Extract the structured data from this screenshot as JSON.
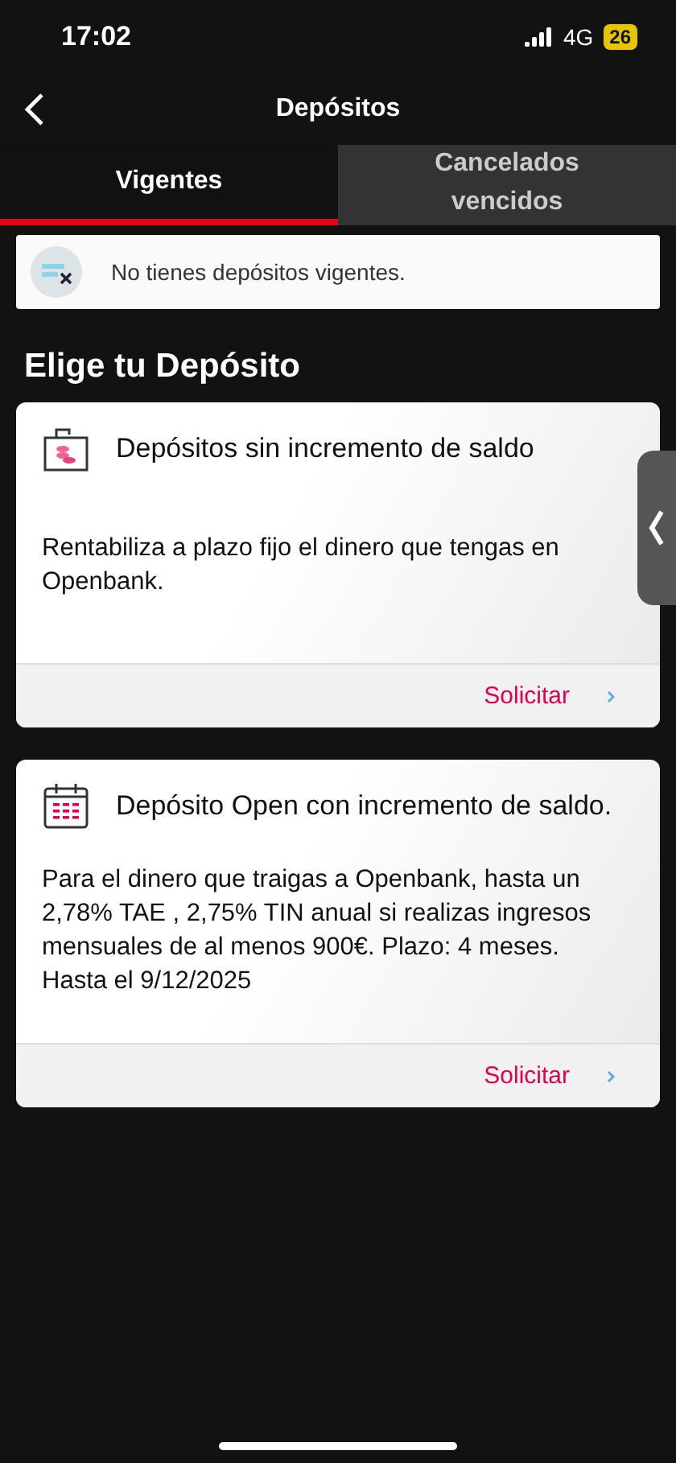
{
  "status_bar": {
    "time": "17:02",
    "network": "4G",
    "battery": "26"
  },
  "header": {
    "title": "Depósitos"
  },
  "tabs": [
    {
      "label": "Vigentes",
      "selected": true
    },
    {
      "label": "Cancelados vencidos",
      "selected": false
    }
  ],
  "notice": {
    "text": "No tienes depósitos vigentes."
  },
  "section_title": "Elige tu Depósito",
  "products": [
    {
      "kind": "purse",
      "title": "Depósitos sin incremento de saldo",
      "description": "Rentabiliza a plazo fijo el dinero que tengas en Openbank.",
      "action": "Solicitar"
    },
    {
      "kind": "calendar",
      "title": "Depósito Open con incremento de saldo.",
      "description": "Para el dinero que traigas a Openbank, hasta un 2,78% TAE , 2,75% TIN anual si realizas ingresos mensuales de al menos 900€. Plazo: 4 meses. Hasta el 9/12/2025",
      "action": "Solicitar"
    }
  ]
}
